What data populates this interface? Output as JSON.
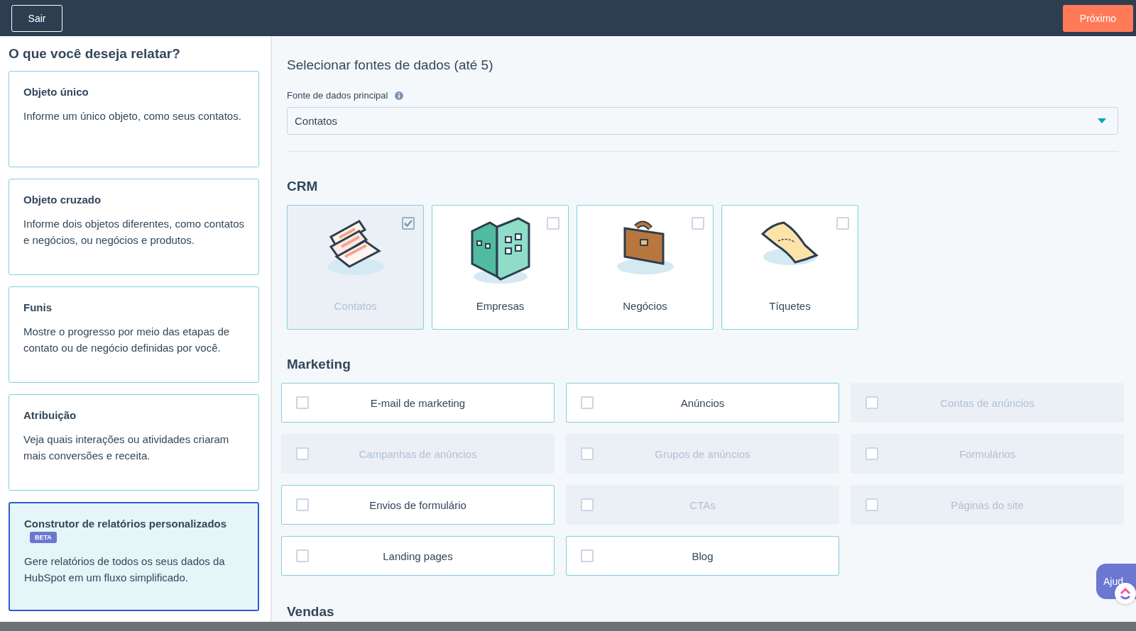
{
  "top_bar": {
    "exit_button": "Sair",
    "next_button": "Próximo"
  },
  "sidebar": {
    "title": "O que você deseja relatar?",
    "options": [
      {
        "title": "Objeto único",
        "description": "Informe um único objeto, como seus contatos.",
        "selected": false
      },
      {
        "title": "Objeto cruzado",
        "description": "Informe dois objetos diferentes, como contatos e negócios, ou negócios e produtos.",
        "selected": false
      },
      {
        "title": "Funis",
        "description": "Mostre o progresso por meio das etapas de contato ou de negócio definidas por você.",
        "selected": false
      },
      {
        "title": "Atribuição",
        "description": "Veja quais interações ou atividades criaram mais conversões e receita.",
        "selected": false
      },
      {
        "title": "Construtor de relatórios personalizados",
        "badge": "BETA",
        "description": "Gere relatórios de todos os seus dados da HubSpot em um fluxo simplificado.",
        "selected": true
      }
    ]
  },
  "main": {
    "title": "Selecionar fontes de dados (até 5)",
    "primary_source": {
      "label": "Fonte de dados principal",
      "value": "Contatos"
    },
    "crm": {
      "heading": "CRM",
      "items": [
        {
          "label": "Contatos",
          "kind": "contacts",
          "checked": true,
          "disabled": true
        },
        {
          "label": "Empresas",
          "kind": "companies",
          "checked": false,
          "disabled": false
        },
        {
          "label": "Negócios",
          "kind": "deals",
          "checked": false,
          "disabled": false
        },
        {
          "label": "Tíquetes",
          "kind": "tickets",
          "checked": false,
          "disabled": false
        }
      ]
    },
    "marketing": {
      "heading": "Marketing",
      "items": [
        {
          "label": "E-mail de marketing",
          "checked": false,
          "disabled": false
        },
        {
          "label": "Anúncios",
          "checked": false,
          "disabled": false
        },
        {
          "label": "Contas de anúncios",
          "checked": false,
          "disabled": true
        },
        {
          "label": "Campanhas de anúncios",
          "checked": false,
          "disabled": true
        },
        {
          "label": "Grupos de anúncios",
          "checked": false,
          "disabled": true
        },
        {
          "label": "Formulários",
          "checked": false,
          "disabled": true
        },
        {
          "label": "Envios de formulário",
          "checked": false,
          "disabled": false
        },
        {
          "label": "CTAs",
          "checked": false,
          "disabled": true
        },
        {
          "label": "Páginas do site",
          "checked": false,
          "disabled": true
        },
        {
          "label": "Landing pages",
          "checked": false,
          "disabled": false
        },
        {
          "label": "Blog",
          "checked": false,
          "disabled": false
        }
      ]
    },
    "sales_heading": "Vendas"
  },
  "help_button": "Ajud"
}
